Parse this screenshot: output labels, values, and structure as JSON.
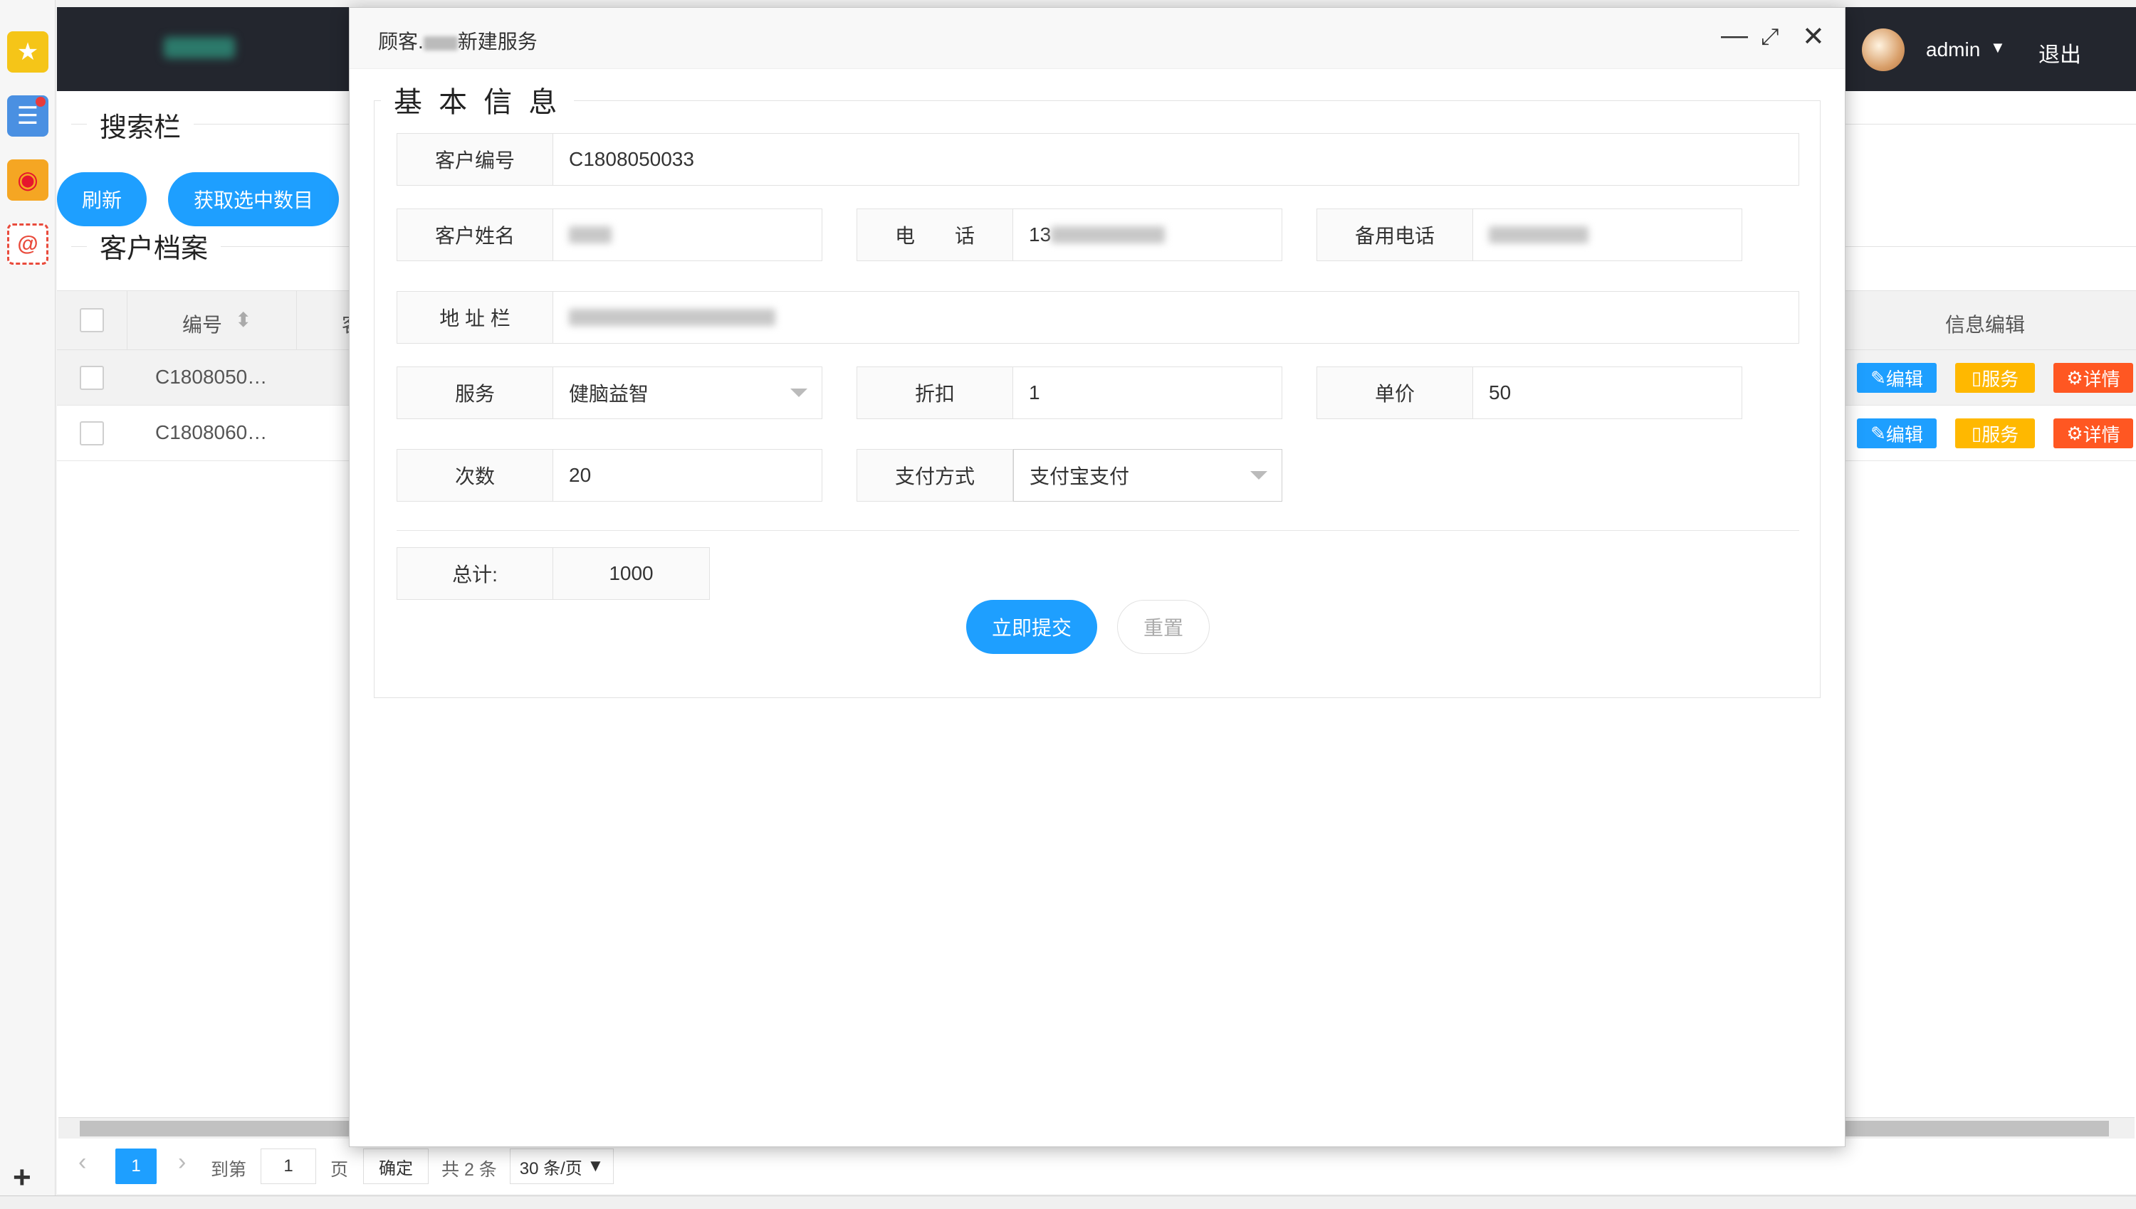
{
  "header": {
    "user_name": "admin",
    "logout_label": "退出"
  },
  "search_section": {
    "title": "搜索栏",
    "refresh_button": "刷新",
    "get_selected_button": "获取选中数目"
  },
  "archive_section": {
    "title": "客户档案"
  },
  "table": {
    "columns": [
      "编号",
      "客",
      "信息编辑"
    ],
    "rows": [
      {
        "id": "C1808050…",
        "actions": [
          "编辑",
          "服务",
          "详情"
        ]
      },
      {
        "id": "C1808060…",
        "actions": [
          "编辑",
          "服务",
          "详情"
        ]
      }
    ]
  },
  "pagination": {
    "current_page": "1",
    "goto_label": "到第",
    "goto_value": "1",
    "page_unit": "页",
    "confirm_label": "确定",
    "total_label": "共 2 条",
    "page_size": "30 条/页"
  },
  "modal": {
    "title_prefix": "顾客.",
    "title_suffix": "新建服务",
    "section_title": "基 本 信 息",
    "fields": {
      "customer_no_label": "客户编号",
      "customer_no_value": "C1808050033",
      "customer_name_label": "客户姓名",
      "phone_label": "电　　话",
      "phone_value_prefix": "13",
      "backup_phone_label": "备用电话",
      "address_label": "地 址 栏",
      "service_label": "服务",
      "service_value": "健脑益智",
      "discount_label": "折扣",
      "discount_value": "1",
      "unit_price_label": "单价",
      "unit_price_value": "50",
      "count_label": "次数",
      "count_value": "20",
      "payment_label": "支付方式",
      "payment_value": "支付宝支付",
      "total_label": "总计:",
      "total_value": "1000"
    },
    "submit_label": "立即提交",
    "reset_label": "重置"
  },
  "colors": {
    "primary": "#1e9fff",
    "warn": "#ffb800",
    "danger": "#ff5722",
    "header_bg": "#23262e"
  }
}
